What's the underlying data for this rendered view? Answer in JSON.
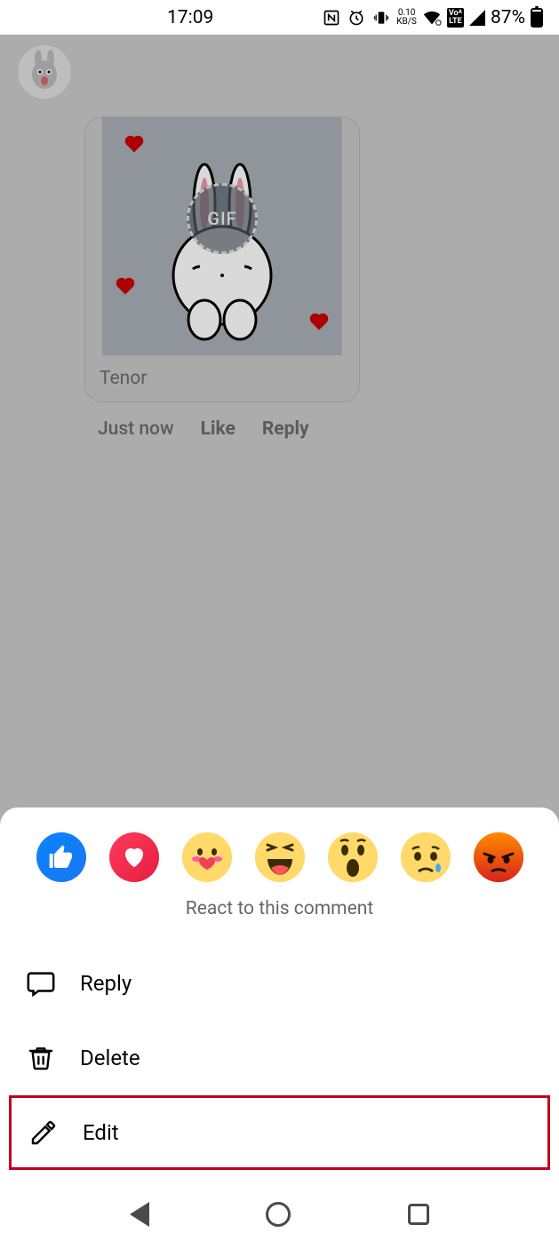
{
  "status": {
    "time": "17:09",
    "kbs_value": "0.10",
    "kbs_label": "KB/S",
    "volte": "Voᴬ LTE",
    "battery_percent": "87%"
  },
  "comment": {
    "source_label": "Tenor",
    "gif_label": "GIF",
    "timestamp": "Just now",
    "like_label": "Like",
    "reply_label": "Reply"
  },
  "sheet": {
    "react_caption": "React to this comment",
    "options": {
      "reply": "Reply",
      "delete": "Delete",
      "edit": "Edit"
    }
  }
}
